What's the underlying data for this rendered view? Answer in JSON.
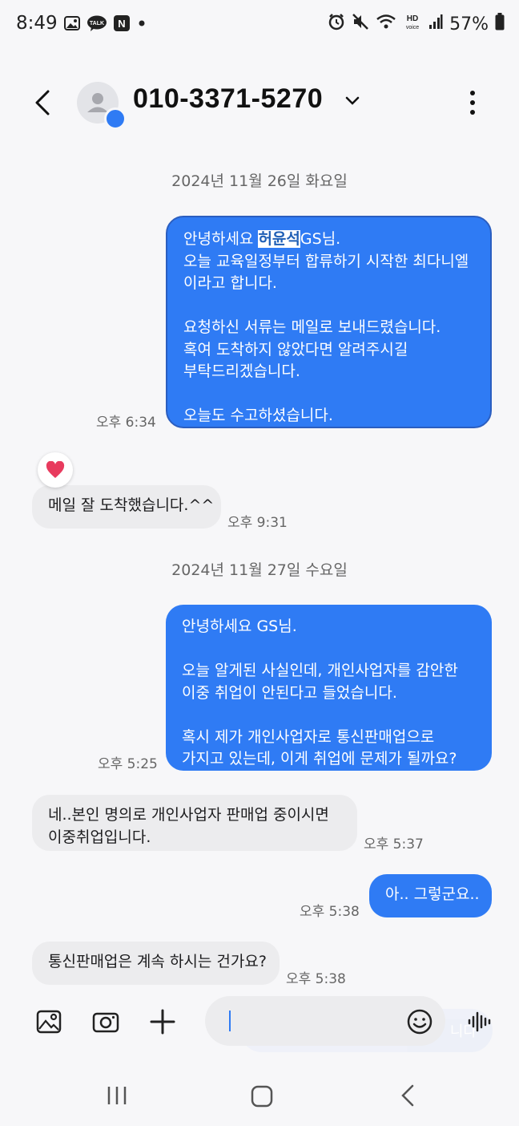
{
  "status_bar": {
    "time": "8:49",
    "left_icons": [
      "gallery-icon",
      "kakaotalk-icon",
      "naver-icon",
      "dot-icon"
    ],
    "kakao_label": "TALK",
    "naver_label": "N",
    "right_icons": [
      "alarm-icon",
      "mute-icon",
      "wifi-icon",
      "hd-voice-icon",
      "signal-icon",
      "battery-icon"
    ],
    "hd_label": "HD",
    "voice_label": "voice",
    "battery": "57%"
  },
  "header": {
    "contact": "010-3371-5270"
  },
  "conversation": {
    "date1": "2024년 11월 26일 화요일",
    "msg1": {
      "lines": [
        "안녕하세요 ",
        "허윤석",
        "GS님.",
        "오늘 교육일정부터 합류하기 시작한 최다니엘",
        "이라고 합니다.",
        "",
        "요청하신 서류는 메일로 보내드렸습니다.",
        "혹여 도착하지 않았다면 알려주시길",
        "부탁드리겠습니다.",
        "",
        "오늘도 수고하셨습니다."
      ],
      "time": "오후 6:34"
    },
    "msg2": {
      "text": "메일 잘 도착했습니다.^^",
      "time": "오후 9:31",
      "reaction": "heart"
    },
    "date2": "2024년 11월 27일 수요일",
    "msg3": {
      "lines": [
        "안녕하세요 GS님.",
        "",
        "오늘 알게된 사실인데, 개인사업자를 감안한",
        "이중 취업이 안된다고 들었습니다.",
        "",
        "혹시 제가 개인사업자로 통신판매업으로",
        "가지고 있는데, 이게 취업에 문제가 될까요?"
      ],
      "time": "오후 5:25"
    },
    "msg4": {
      "lines": [
        "네..본인 명의로 개인사업자 판매업 중이시면",
        "이중취업입니다."
      ],
      "time": "오후 5:37"
    },
    "msg5": {
      "text": "아.. 그렇군요..",
      "time": "오후 5:38"
    },
    "msg6": {
      "text": "통신판매업은 계속 하시는 건가요?",
      "time": "오후 5:38"
    }
  },
  "composer": {
    "input_value": "",
    "ghost_text": "니다"
  },
  "colors": {
    "outgoing": "#2f7bf4",
    "incoming": "#ececee",
    "background": "#f7f7f9"
  }
}
